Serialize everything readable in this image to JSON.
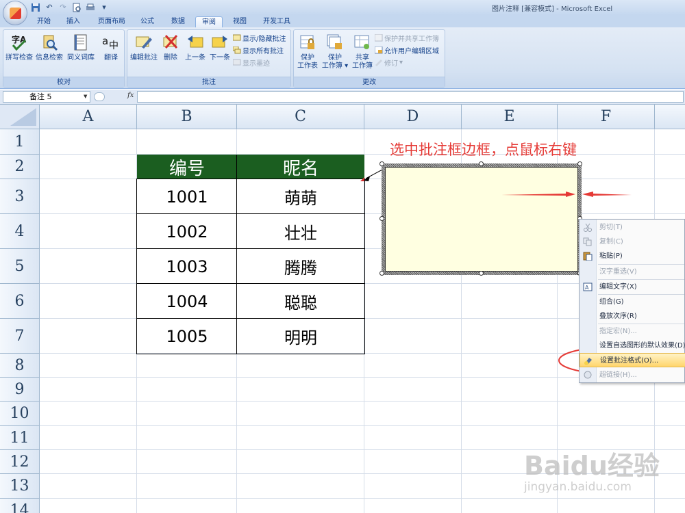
{
  "window": {
    "title": "图片注释 [兼容模式] - Microsoft Excel"
  },
  "tabs": [
    "开始",
    "插入",
    "页面布局",
    "公式",
    "数据",
    "审阅",
    "视图",
    "开发工具"
  ],
  "active_tab": "审阅",
  "ribbon": {
    "proofing": {
      "label": "校对",
      "buttons": [
        "拼写检查",
        "信息检索",
        "同义词库",
        "翻译"
      ]
    },
    "comments": {
      "label": "批注",
      "buttons": [
        "编辑批注",
        "删除",
        "上一条",
        "下一条"
      ],
      "small": [
        "显示/隐藏批注",
        "显示所有批注",
        "显示墨迹"
      ]
    },
    "changes": {
      "label": "更改",
      "protect_sheet": [
        "保护",
        "工作表"
      ],
      "protect_workbook": [
        "保护",
        "工作簿"
      ],
      "share_workbook": [
        "共享",
        "工作簿"
      ],
      "small": [
        "保护并共享工作簿",
        "允许用户编辑区域",
        "修订"
      ]
    }
  },
  "formula_bar": {
    "name_box": "备注 5",
    "fx": "fx",
    "formula": ""
  },
  "columns": [
    "A",
    "B",
    "C",
    "D",
    "E",
    "F"
  ],
  "rows": [
    "1",
    "2",
    "3",
    "4",
    "5",
    "6",
    "7",
    "8",
    "9",
    "10",
    "11",
    "12",
    "13",
    "14"
  ],
  "table": {
    "headers": [
      "编号",
      "昵名"
    ],
    "rows": [
      [
        "1001",
        "萌萌"
      ],
      [
        "1002",
        "壮壮"
      ],
      [
        "1003",
        "腾腾"
      ],
      [
        "1004",
        "聪聪"
      ],
      [
        "1005",
        "明明"
      ]
    ],
    "header_color": "#1b5e20"
  },
  "annotation": {
    "text": "选中批注框边框，点鼠标右键",
    "color": "#e53935"
  },
  "context_menu": {
    "items": [
      {
        "label": "剪切(T)",
        "icon": "scissors-icon",
        "enabled": false
      },
      {
        "label": "复制(C)",
        "icon": "copy-icon",
        "enabled": false
      },
      {
        "label": "粘贴(P)",
        "icon": "paste-icon",
        "enabled": true
      },
      {
        "label": "汉字重选(V)",
        "icon": "",
        "enabled": false
      },
      {
        "label": "编辑文字(X)",
        "icon": "edit-text-icon",
        "enabled": true
      },
      {
        "label": "组合(G)",
        "icon": "",
        "enabled": true
      },
      {
        "label": "叠放次序(R)",
        "icon": "",
        "enabled": true
      },
      {
        "label": "指定宏(N)...",
        "icon": "",
        "enabled": false
      },
      {
        "label": "设置自选图形的默认效果(D)",
        "icon": "",
        "enabled": true
      },
      {
        "label": "设置批注格式(O)...",
        "icon": "format-comment-icon",
        "enabled": true,
        "highlighted": true
      },
      {
        "label": "超链接(H)...",
        "icon": "hyperlink-icon",
        "enabled": false
      }
    ]
  },
  "watermark": {
    "logo": "Baidu经验",
    "url": "jingyan.baidu.com"
  }
}
